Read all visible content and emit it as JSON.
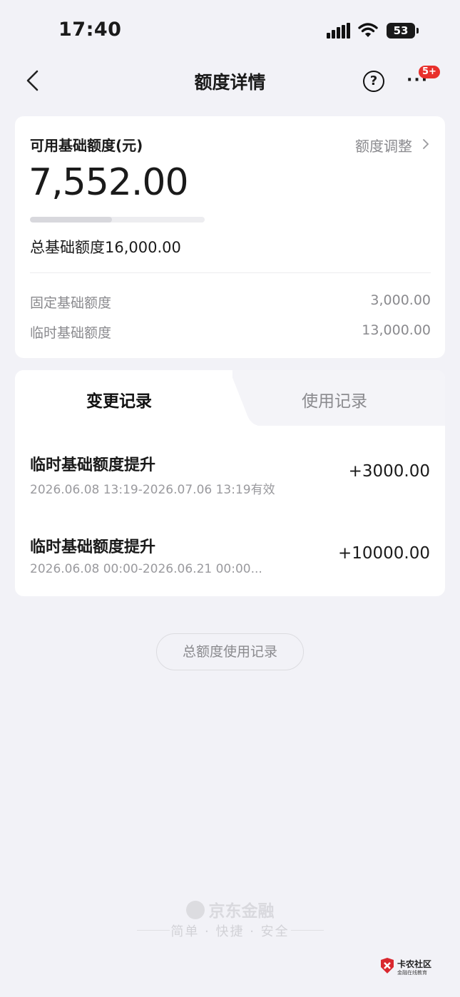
{
  "status_bar": {
    "time": "17:40",
    "battery": "53"
  },
  "nav": {
    "title": "额度详情",
    "help": "?",
    "more": "···",
    "badge": "5+"
  },
  "summary": {
    "available_label": "可用基础额度(元)",
    "adjust_label": "额度调整",
    "available_amount": "7,552.00",
    "usage_fraction": 0.47,
    "total_label": "总基础额度16,000.00",
    "rows": [
      {
        "label": "固定基础额度",
        "value": "3,000.00"
      },
      {
        "label": "临时基础额度",
        "value": "13,000.00"
      }
    ]
  },
  "tabs": [
    {
      "label": "变更记录",
      "active": true
    },
    {
      "label": "使用记录",
      "active": false
    }
  ],
  "records": [
    {
      "title": "临时基础额度提升",
      "subtitle": "2026.06.08 13:19-2026.07.06 13:19有效",
      "amount": "+3000.00"
    },
    {
      "title": "临时基础额度提升",
      "subtitle": "2026.06.08 00:00-2026.06.21 00:00...",
      "amount": "+10000.00"
    }
  ],
  "history_button": "总额度使用记录",
  "footer": {
    "brand": "京东金融",
    "slogan": "简单 · 快捷 · 安全"
  },
  "watermark": {
    "title": "卡农社区",
    "subtitle": "金融在线教育"
  }
}
